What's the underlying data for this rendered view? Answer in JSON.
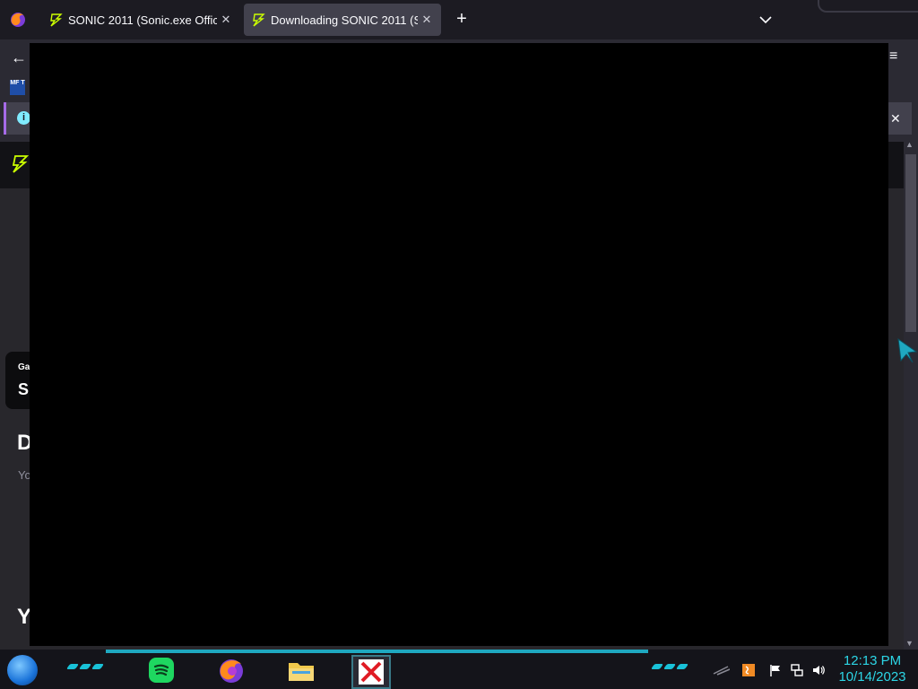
{
  "browser": {
    "tabs": [
      {
        "title": "SONIC 2011 (Sonic.exe Official",
        "close": "✕"
      },
      {
        "title": "Downloading SONIC 2011 (Sonic",
        "close": "✕"
      }
    ],
    "new_tab": "+",
    "back": "←",
    "menu": "≡"
  },
  "page": {
    "ext_badge": "MF T",
    "info_icon": "i",
    "info_close": "✕",
    "card_tag": "Ga",
    "card_letter": "S",
    "heading_fragment": "D",
    "text_fragment": "Yo",
    "heading2_fragment": "Y",
    "scroll_up": "▲",
    "scroll_down": "▼"
  },
  "taskbar": {
    "apps": [
      "spotify-icon",
      "firefox-icon",
      "file-explorer-icon",
      "red-x-icon"
    ],
    "time": "12:13 PM",
    "date": "10/14/2023"
  },
  "colors": {
    "accent": "#19c2d8",
    "tab_active": "#42414d",
    "overlay": "#000000"
  }
}
